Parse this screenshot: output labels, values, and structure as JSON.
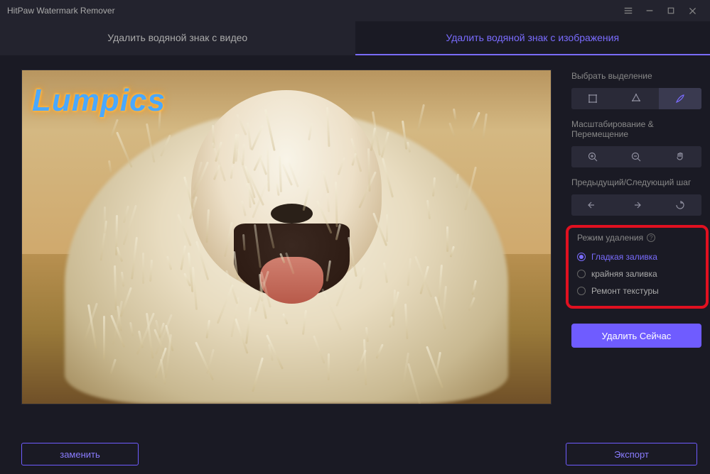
{
  "app": {
    "title": "HitPaw Watermark Remover"
  },
  "tabs": {
    "video": "Удалить водяной знак с видео",
    "image": "Удалить водяной знак с изображения"
  },
  "watermark_text": "Lumpics",
  "sidebar": {
    "selection_label": "Выбрать выделение",
    "zoom_label": "Масштабирование & Перемещение",
    "history_label": "Предыдущий/Следующий шаг",
    "mode_label": "Режим удаления",
    "modes": [
      {
        "label": "Гладкая заливка",
        "selected": true
      },
      {
        "label": "крайняя заливка",
        "selected": false
      },
      {
        "label": "Ремонт текстуры",
        "selected": false
      }
    ],
    "remove_now": "Удалить Сейчас"
  },
  "footer": {
    "replace": "заменить",
    "export": "Экспорт"
  },
  "icons": {
    "rect": "rect-select",
    "lasso": "lasso-select",
    "brush": "brush-select",
    "zoom_in": "zoom-in",
    "zoom_out": "zoom-out",
    "pan": "pan-hand",
    "undo": "undo",
    "redo": "redo",
    "reset": "reset"
  }
}
